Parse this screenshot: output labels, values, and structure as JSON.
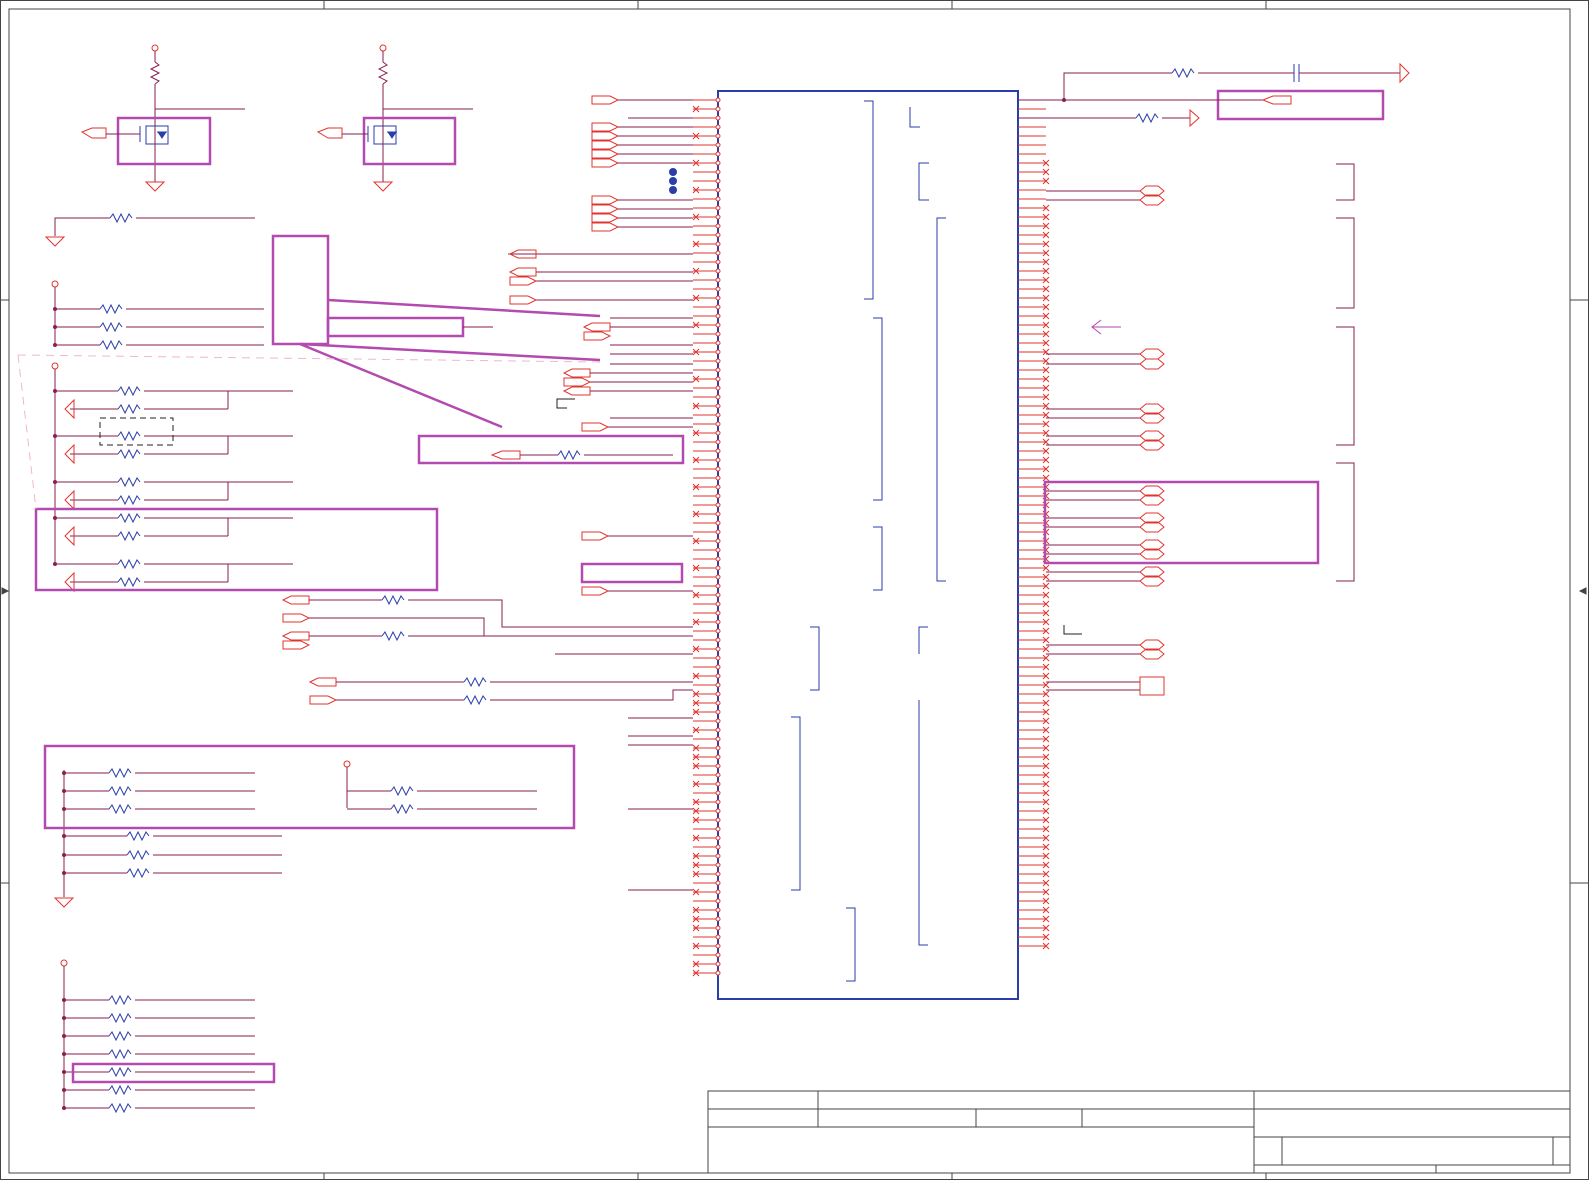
{
  "sheet": {
    "title_block": {
      "title": "",
      "size": "",
      "document_number": "",
      "revision": "",
      "date": "",
      "sheet": ""
    }
  },
  "colors": {
    "frame": "#444444",
    "wire": "#8a1e4f",
    "pin": "#e0342f",
    "component_body": "#2a3da8",
    "highlight": "#b24ab0",
    "power_symbol": "#e0342f",
    "junction": "#2a3da8"
  },
  "icons": {
    "resistor": "resistor-icon",
    "capacitor": "capacitor-icon",
    "mosfet": "mosfet-icon",
    "ground": "ground-icon",
    "power": "power-icon",
    "port": "net-port-icon",
    "no_connect": "no-connect-icon",
    "arrow": "arrow-icon"
  }
}
